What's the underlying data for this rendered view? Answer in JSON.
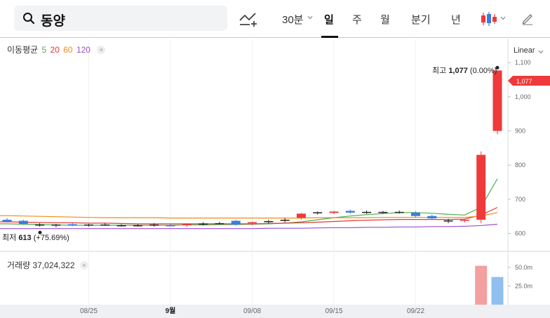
{
  "search": {
    "query": "동양"
  },
  "periods": {
    "interval": "30분",
    "day": "일",
    "week": "주",
    "month": "월",
    "quarter": "분기",
    "year": "년"
  },
  "indicators": {
    "title": "이동평균",
    "ma": [
      {
        "label": "5",
        "color": "#4caf50"
      },
      {
        "label": "20",
        "color": "#e53935"
      },
      {
        "label": "60",
        "color": "#ef8a17"
      },
      {
        "label": "120",
        "color": "#9c4dcc"
      }
    ]
  },
  "scale": {
    "label": "Linear"
  },
  "high": {
    "prefix": "최고",
    "value": "1,077",
    "change": "(0.00%)"
  },
  "low": {
    "prefix": "최저",
    "value": "613",
    "change": "(+75.69%)"
  },
  "current_price_tag": "1,077",
  "volume": {
    "label": "거래량",
    "value": "37,024,322"
  },
  "chart_data": {
    "type": "candlestick",
    "price_axis": {
      "ticks": [
        600,
        700,
        800,
        900,
        1000,
        1100
      ],
      "labels": [
        "600",
        "700",
        "800",
        "900",
        "1,000",
        "1,100"
      ],
      "range": [
        560,
        1160
      ]
    },
    "volume_axis": {
      "ticks": [
        25,
        50
      ],
      "labels": [
        "25.0m",
        "50.0m"
      ],
      "range": [
        0,
        62
      ]
    },
    "x_labels": [
      {
        "label": "08/25",
        "index": 5
      },
      {
        "label": "9월",
        "index": 10
      },
      {
        "label": "09/08",
        "index": 15
      },
      {
        "label": "09/15",
        "index": 20
      },
      {
        "label": "09/22",
        "index": 25
      }
    ],
    "candles": [
      {
        "o": 640,
        "h": 645,
        "l": 632,
        "c": 635,
        "v": 1
      },
      {
        "o": 637,
        "h": 640,
        "l": 625,
        "c": 628,
        "v": 1
      },
      {
        "o": 626,
        "h": 630,
        "l": 620,
        "c": 624,
        "v": 1
      },
      {
        "o": 624,
        "h": 628,
        "l": 618,
        "c": 626,
        "v": 1
      },
      {
        "o": 627,
        "h": 630,
        "l": 621,
        "c": 623,
        "v": 1
      },
      {
        "o": 624,
        "h": 628,
        "l": 620,
        "c": 626,
        "v": 1
      },
      {
        "o": 626,
        "h": 630,
        "l": 622,
        "c": 625,
        "v": 1
      },
      {
        "o": 624,
        "h": 627,
        "l": 620,
        "c": 624,
        "v": 1
      },
      {
        "o": 624,
        "h": 627,
        "l": 620,
        "c": 623,
        "v": 1
      },
      {
        "o": 624,
        "h": 630,
        "l": 620,
        "c": 626,
        "v": 1
      },
      {
        "o": 624,
        "h": 628,
        "l": 620,
        "c": 621,
        "v": 1
      },
      {
        "o": 624,
        "h": 630,
        "l": 620,
        "c": 627,
        "v": 1
      },
      {
        "o": 627,
        "h": 633,
        "l": 623,
        "c": 629,
        "v": 1
      },
      {
        "o": 630,
        "h": 634,
        "l": 626,
        "c": 628,
        "v": 1
      },
      {
        "o": 637,
        "h": 640,
        "l": 623,
        "c": 626,
        "v": 1
      },
      {
        "o": 630,
        "h": 635,
        "l": 624,
        "c": 633,
        "v": 1
      },
      {
        "o": 634,
        "h": 640,
        "l": 629,
        "c": 636,
        "v": 1
      },
      {
        "o": 639,
        "h": 645,
        "l": 632,
        "c": 640,
        "v": 1
      },
      {
        "o": 646,
        "h": 660,
        "l": 641,
        "c": 658,
        "v": 1
      },
      {
        "o": 660,
        "h": 664,
        "l": 655,
        "c": 662,
        "v": 1
      },
      {
        "o": 660,
        "h": 666,
        "l": 657,
        "c": 664,
        "v": 1
      },
      {
        "o": 666,
        "h": 670,
        "l": 658,
        "c": 661,
        "v": 1
      },
      {
        "o": 663,
        "h": 667,
        "l": 657,
        "c": 661,
        "v": 1
      },
      {
        "o": 662,
        "h": 666,
        "l": 658,
        "c": 663,
        "v": 1
      },
      {
        "o": 663,
        "h": 667,
        "l": 658,
        "c": 662,
        "v": 1
      },
      {
        "o": 661,
        "h": 665,
        "l": 648,
        "c": 651,
        "v": 1
      },
      {
        "o": 651,
        "h": 655,
        "l": 641,
        "c": 644,
        "v": 1
      },
      {
        "o": 638,
        "h": 643,
        "l": 630,
        "c": 636,
        "v": 1
      },
      {
        "o": 637,
        "h": 641,
        "l": 632,
        "c": 640,
        "v": 1
      },
      {
        "o": 640,
        "h": 840,
        "l": 630,
        "c": 830,
        "v": 52
      },
      {
        "o": 900,
        "h": 1077,
        "l": 890,
        "c": 1077,
        "v": 37
      }
    ],
    "ma_series": [
      {
        "name": "5",
        "color": "#4caf50",
        "values": [
          628,
          627,
          626,
          625,
          624,
          624,
          624,
          624,
          624,
          624,
          624,
          625,
          625,
          626,
          626,
          627,
          628,
          630,
          634,
          640,
          646,
          651,
          655,
          658,
          661,
          661,
          659,
          656,
          654,
          677,
          760
        ]
      },
      {
        "name": "20",
        "color": "#e53935",
        "values": [
          634,
          633,
          632,
          631,
          631,
          630,
          630,
          629,
          628,
          628,
          628,
          628,
          628,
          628,
          628,
          628,
          629,
          630,
          631,
          633,
          635,
          637,
          639,
          640,
          641,
          641,
          641,
          641,
          642,
          654,
          676
        ]
      },
      {
        "name": "60",
        "color": "#ef8a17",
        "values": [
          652,
          651,
          650,
          649,
          648,
          647,
          646,
          646,
          646,
          646,
          645,
          645,
          645,
          645,
          645,
          645,
          645,
          645,
          645,
          646,
          646,
          646,
          646,
          647,
          647,
          647,
          647,
          647,
          647,
          651,
          661
        ]
      },
      {
        "name": "120",
        "color": "#9c4dcc",
        "values": [
          614,
          614,
          614,
          614,
          614,
          614,
          614,
          614,
          614,
          614,
          614,
          614,
          614,
          614,
          614,
          614,
          615,
          615,
          615,
          616,
          617,
          617,
          618,
          618,
          619,
          619,
          620,
          620,
          621,
          623,
          627
        ]
      }
    ],
    "colors": {
      "up": "#ee3a3a",
      "down": "#3b7ddd",
      "vol_up": "#f3a0a0",
      "vol_down": "#8fc0f0"
    }
  }
}
